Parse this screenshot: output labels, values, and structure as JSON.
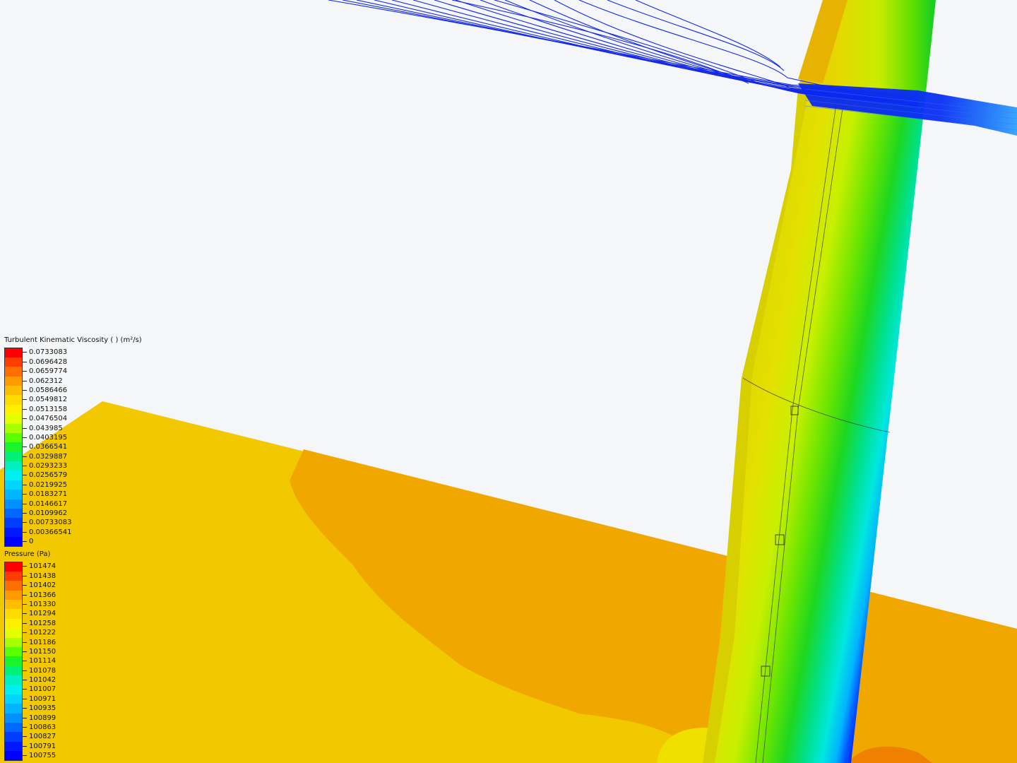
{
  "legend_viscosity": {
    "title": "Turbulent Kinematic Viscosity (      ) (m²/s)",
    "entries": [
      {
        "label": "0.0733083",
        "color": "#ff0000"
      },
      {
        "label": "0.0696428",
        "color": "#ff3d00"
      },
      {
        "label": "0.0659774",
        "color": "#ff6e00"
      },
      {
        "label": "0.062312",
        "color": "#ff9a00"
      },
      {
        "label": "0.0586466",
        "color": "#ffbe00"
      },
      {
        "label": "0.0549812",
        "color": "#ffdc00"
      },
      {
        "label": "0.0513158",
        "color": "#fff000"
      },
      {
        "label": "0.0476504",
        "color": "#e6ff00"
      },
      {
        "label": "0.043985",
        "color": "#a8ff00"
      },
      {
        "label": "0.0403195",
        "color": "#5aff00"
      },
      {
        "label": "0.0366541",
        "color": "#19f52a"
      },
      {
        "label": "0.0329887",
        "color": "#00f07a"
      },
      {
        "label": "0.0293233",
        "color": "#00f0c2"
      },
      {
        "label": "0.0256579",
        "color": "#00f0f0"
      },
      {
        "label": "0.0219925",
        "color": "#00d4ff"
      },
      {
        "label": "0.0183271",
        "color": "#00b4ff"
      },
      {
        "label": "0.0146617",
        "color": "#0090ff"
      },
      {
        "label": "0.0109962",
        "color": "#0068ff"
      },
      {
        "label": "0.00733083",
        "color": "#003dff"
      },
      {
        "label": "0.00366541",
        "color": "#0018ff"
      },
      {
        "label": "0",
        "color": "#0000ff"
      }
    ]
  },
  "legend_pressure": {
    "title": "Pressure (Pa)",
    "entries": [
      {
        "label": "101474",
        "color": "#ff0000"
      },
      {
        "label": "101438",
        "color": "#ff3d00"
      },
      {
        "label": "101402",
        "color": "#ff6e00"
      },
      {
        "label": "101366",
        "color": "#ff9a00"
      },
      {
        "label": "101330",
        "color": "#ffbe00"
      },
      {
        "label": "101294",
        "color": "#ffdc00"
      },
      {
        "label": "101258",
        "color": "#fff000"
      },
      {
        "label": "101222",
        "color": "#e6ff00"
      },
      {
        "label": "101186",
        "color": "#a8ff00"
      },
      {
        "label": "101150",
        "color": "#5aff00"
      },
      {
        "label": "101114",
        "color": "#19f52a"
      },
      {
        "label": "101078",
        "color": "#00f07a"
      },
      {
        "label": "101042",
        "color": "#00f0c2"
      },
      {
        "label": "101007",
        "color": "#00f0f0"
      },
      {
        "label": "100971",
        "color": "#00d4ff"
      },
      {
        "label": "100935",
        "color": "#00b4ff"
      },
      {
        "label": "100899",
        "color": "#0090ff"
      },
      {
        "label": "100863",
        "color": "#0068ff"
      },
      {
        "label": "100827",
        "color": "#003dff"
      },
      {
        "label": "100791",
        "color": "#0018ff"
      },
      {
        "label": "100755",
        "color": "#0000ff"
      }
    ]
  },
  "colors": {
    "background": "#f5f6f7",
    "ground_light": "#f2c800",
    "ground_dark": "#f0a800",
    "streamline": "#1428e6"
  }
}
